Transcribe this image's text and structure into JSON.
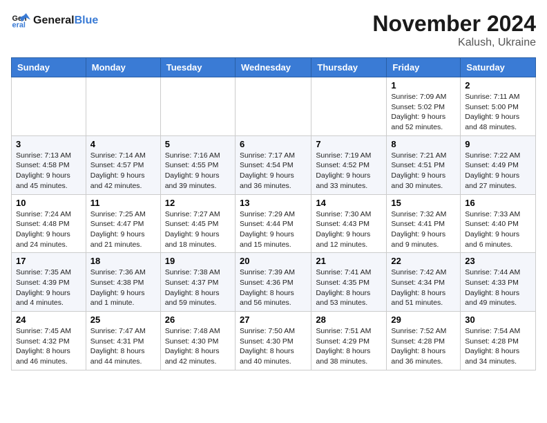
{
  "header": {
    "logo_line1": "General",
    "logo_line2": "Blue",
    "month": "November 2024",
    "location": "Kalush, Ukraine"
  },
  "weekdays": [
    "Sunday",
    "Monday",
    "Tuesday",
    "Wednesday",
    "Thursday",
    "Friday",
    "Saturday"
  ],
  "weeks": [
    [
      {
        "day": "",
        "info": ""
      },
      {
        "day": "",
        "info": ""
      },
      {
        "day": "",
        "info": ""
      },
      {
        "day": "",
        "info": ""
      },
      {
        "day": "",
        "info": ""
      },
      {
        "day": "1",
        "info": "Sunrise: 7:09 AM\nSunset: 5:02 PM\nDaylight: 9 hours\nand 52 minutes."
      },
      {
        "day": "2",
        "info": "Sunrise: 7:11 AM\nSunset: 5:00 PM\nDaylight: 9 hours\nand 48 minutes."
      }
    ],
    [
      {
        "day": "3",
        "info": "Sunrise: 7:13 AM\nSunset: 4:58 PM\nDaylight: 9 hours\nand 45 minutes."
      },
      {
        "day": "4",
        "info": "Sunrise: 7:14 AM\nSunset: 4:57 PM\nDaylight: 9 hours\nand 42 minutes."
      },
      {
        "day": "5",
        "info": "Sunrise: 7:16 AM\nSunset: 4:55 PM\nDaylight: 9 hours\nand 39 minutes."
      },
      {
        "day": "6",
        "info": "Sunrise: 7:17 AM\nSunset: 4:54 PM\nDaylight: 9 hours\nand 36 minutes."
      },
      {
        "day": "7",
        "info": "Sunrise: 7:19 AM\nSunset: 4:52 PM\nDaylight: 9 hours\nand 33 minutes."
      },
      {
        "day": "8",
        "info": "Sunrise: 7:21 AM\nSunset: 4:51 PM\nDaylight: 9 hours\nand 30 minutes."
      },
      {
        "day": "9",
        "info": "Sunrise: 7:22 AM\nSunset: 4:49 PM\nDaylight: 9 hours\nand 27 minutes."
      }
    ],
    [
      {
        "day": "10",
        "info": "Sunrise: 7:24 AM\nSunset: 4:48 PM\nDaylight: 9 hours\nand 24 minutes."
      },
      {
        "day": "11",
        "info": "Sunrise: 7:25 AM\nSunset: 4:47 PM\nDaylight: 9 hours\nand 21 minutes."
      },
      {
        "day": "12",
        "info": "Sunrise: 7:27 AM\nSunset: 4:45 PM\nDaylight: 9 hours\nand 18 minutes."
      },
      {
        "day": "13",
        "info": "Sunrise: 7:29 AM\nSunset: 4:44 PM\nDaylight: 9 hours\nand 15 minutes."
      },
      {
        "day": "14",
        "info": "Sunrise: 7:30 AM\nSunset: 4:43 PM\nDaylight: 9 hours\nand 12 minutes."
      },
      {
        "day": "15",
        "info": "Sunrise: 7:32 AM\nSunset: 4:41 PM\nDaylight: 9 hours\nand 9 minutes."
      },
      {
        "day": "16",
        "info": "Sunrise: 7:33 AM\nSunset: 4:40 PM\nDaylight: 9 hours\nand 6 minutes."
      }
    ],
    [
      {
        "day": "17",
        "info": "Sunrise: 7:35 AM\nSunset: 4:39 PM\nDaylight: 9 hours\nand 4 minutes."
      },
      {
        "day": "18",
        "info": "Sunrise: 7:36 AM\nSunset: 4:38 PM\nDaylight: 9 hours\nand 1 minute."
      },
      {
        "day": "19",
        "info": "Sunrise: 7:38 AM\nSunset: 4:37 PM\nDaylight: 8 hours\nand 59 minutes."
      },
      {
        "day": "20",
        "info": "Sunrise: 7:39 AM\nSunset: 4:36 PM\nDaylight: 8 hours\nand 56 minutes."
      },
      {
        "day": "21",
        "info": "Sunrise: 7:41 AM\nSunset: 4:35 PM\nDaylight: 8 hours\nand 53 minutes."
      },
      {
        "day": "22",
        "info": "Sunrise: 7:42 AM\nSunset: 4:34 PM\nDaylight: 8 hours\nand 51 minutes."
      },
      {
        "day": "23",
        "info": "Sunrise: 7:44 AM\nSunset: 4:33 PM\nDaylight: 8 hours\nand 49 minutes."
      }
    ],
    [
      {
        "day": "24",
        "info": "Sunrise: 7:45 AM\nSunset: 4:32 PM\nDaylight: 8 hours\nand 46 minutes."
      },
      {
        "day": "25",
        "info": "Sunrise: 7:47 AM\nSunset: 4:31 PM\nDaylight: 8 hours\nand 44 minutes."
      },
      {
        "day": "26",
        "info": "Sunrise: 7:48 AM\nSunset: 4:30 PM\nDaylight: 8 hours\nand 42 minutes."
      },
      {
        "day": "27",
        "info": "Sunrise: 7:50 AM\nSunset: 4:30 PM\nDaylight: 8 hours\nand 40 minutes."
      },
      {
        "day": "28",
        "info": "Sunrise: 7:51 AM\nSunset: 4:29 PM\nDaylight: 8 hours\nand 38 minutes."
      },
      {
        "day": "29",
        "info": "Sunrise: 7:52 AM\nSunset: 4:28 PM\nDaylight: 8 hours\nand 36 minutes."
      },
      {
        "day": "30",
        "info": "Sunrise: 7:54 AM\nSunset: 4:28 PM\nDaylight: 8 hours\nand 34 minutes."
      }
    ]
  ]
}
